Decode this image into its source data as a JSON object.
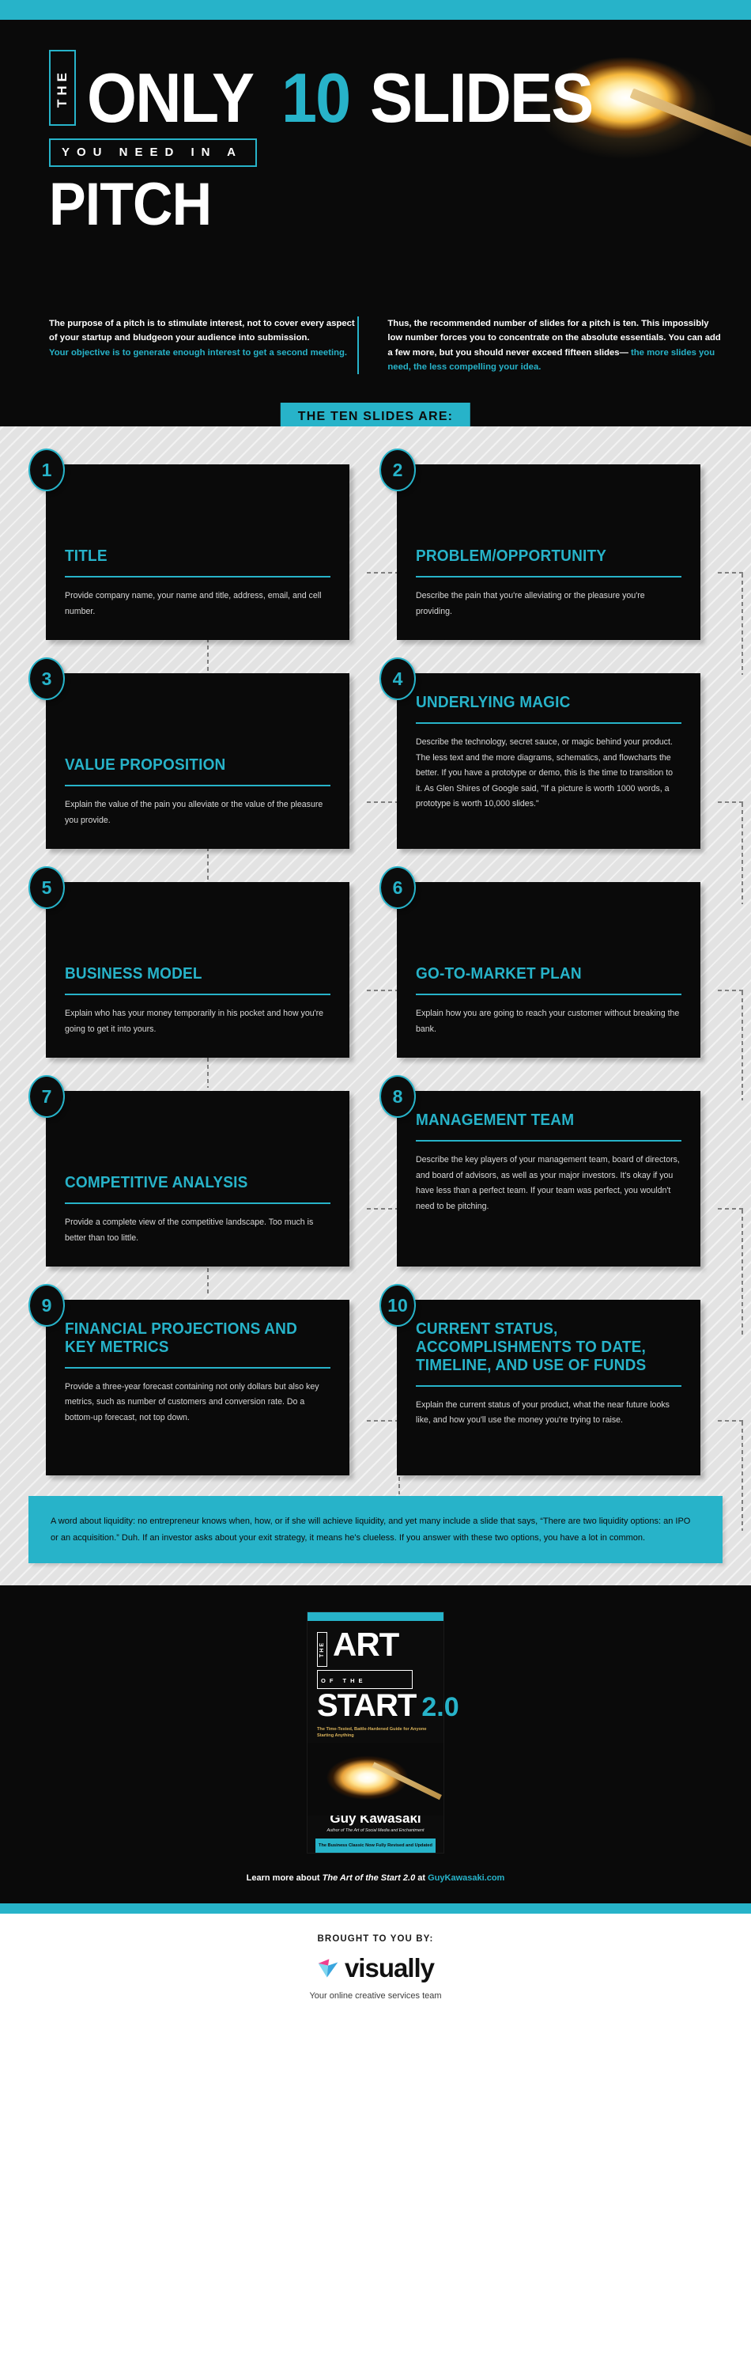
{
  "colors": {
    "accent": "#27b3c9",
    "dark": "#0a0a0a",
    "grey_bg": "#e3e3e3"
  },
  "hero": {
    "the": "THE",
    "only": "ONLY",
    "ten": "10",
    "slides": "SLIDES",
    "you_need_in_a": "YOU NEED IN A",
    "pitch": "PITCH"
  },
  "intro": {
    "left_white": "The purpose of a pitch is to stimulate interest, not to cover every aspect of your startup and bludgeon your audience into submission. ",
    "left_accent": "Your objective is to generate enough interest to get a second meeting.",
    "right_white": "Thus, the recommended number of slides for a pitch is ten. This impossibly low number forces you to concentrate on the absolute essentials. You can add a few more, but you should never exceed fifteen slides—",
    "right_accent": "the more slides you need, the less compelling your idea."
  },
  "banner": {
    "label": "THE TEN SLIDES ARE:"
  },
  "slides": [
    {
      "number": "1",
      "title": "TITLE",
      "body": "Provide company name, your name and title, address, email, and cell number."
    },
    {
      "number": "2",
      "title": "PROBLEM/OPPORTUNITY",
      "body": "Describe the pain that you're alleviating or the pleasure you're providing."
    },
    {
      "number": "3",
      "title": "VALUE PROPOSITION",
      "body": "Explain the value of the pain you alleviate or the value of the pleasure you provide."
    },
    {
      "number": "4",
      "title": "UNDERLYING MAGIC",
      "body": "Describe the technology, secret sauce, or magic behind your product. The less text and the more diagrams, schematics, and flowcharts the better. If you have a prototype or demo, this is the time to transition to it. As Glen Shires of Google said, \"If a picture is worth 1000 words, a prototype is worth 10,000 slides.\""
    },
    {
      "number": "5",
      "title": "BUSINESS MODEL",
      "body": "Explain who has your money temporarily in his pocket and how you're going to get it into yours."
    },
    {
      "number": "6",
      "title": "GO-TO-MARKET PLAN",
      "body": "Explain how you are going to reach your customer without breaking the bank."
    },
    {
      "number": "7",
      "title": "COMPETITIVE ANALYSIS",
      "body": "Provide a complete view of the competitive landscape. Too much is better than too little."
    },
    {
      "number": "8",
      "title": "MANAGEMENT TEAM",
      "body": "Describe the key players of your management team, board of directors, and board of advisors, as well as your major investors. It's okay if you have less than a perfect team. If your team was perfect, you wouldn't need to be pitching."
    },
    {
      "number": "9",
      "title": "FINANCIAL PROJECTIONS AND KEY METRICS",
      "body": "Provide a three-year forecast containing not only dollars but also key metrics, such as number of customers and conversion rate. Do a bottom-up forecast, not top down."
    },
    {
      "number": "10",
      "title": "CURRENT STATUS, ACCOMPLISHMENTS TO DATE, TIMELINE, AND USE OF FUNDS",
      "body": "Explain the current status of your product, what the near future looks like, and how you'll use the money you're trying to raise."
    }
  ],
  "note": {
    "text": "A word about liquidity: no entrepreneur knows when, how, or if she will achieve liquidity, and yet many include a slide that says, “There are two liquidity options: an IPO or an acquisition.” Duh. If an investor asks about your exit strategy, it means he's clueless. If you answer with these two options, you have a lot in common."
  },
  "book": {
    "the": "THE",
    "art": "ART",
    "of_the": "OF THE",
    "start": "START",
    "version": "2.0",
    "subtitle": "The Time-Tested, Battle-Hardened Guide for Anyone Starting Anything",
    "author": "Guy Kawasaki",
    "author_sub": "Author of The Art of Social Media and Enchantment",
    "band": "The Business Classic Now Fully Revised and Updated"
  },
  "learn_more": {
    "prefix": "Learn more about ",
    "title": "The Art of the Start 2.0",
    "middle": " at ",
    "link": "GuyKawasaki.com"
  },
  "footer": {
    "brought": "BROUGHT TO YOU BY:",
    "brand": "visually",
    "tagline": "Your online creative services team"
  }
}
